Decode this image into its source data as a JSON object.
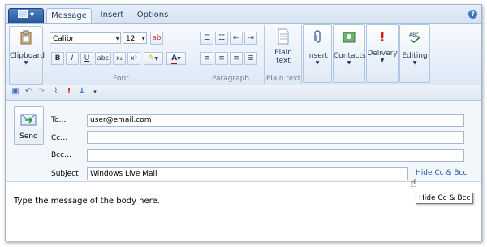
{
  "tabs": {
    "app_menu": "",
    "message": "Message",
    "insert": "Insert",
    "options": "Options"
  },
  "ribbon": {
    "clipboard": "Clipboard",
    "font_label": "Font",
    "font_name": "Calibri",
    "font_size": "12",
    "bold": "B",
    "italic": "I",
    "underline": "U",
    "strike": "abc",
    "subscript": "x₂",
    "superscript": "x²",
    "font_color": "A",
    "paragraph_label": "Paragraph",
    "plain_text_button": "Plain\ntext",
    "plain_text_label": "Plain text",
    "insert": "Insert",
    "contacts": "Contacts",
    "delivery": "Delivery",
    "editing": "Editing"
  },
  "compose": {
    "send": "Send",
    "to_label": "To…",
    "to_value": "user@email.com",
    "cc_label": "Cc…",
    "cc_value": "",
    "bcc_label": "Bcc…",
    "bcc_value": "",
    "subject_label": "Subject",
    "subject_value": "Windows Live Mail",
    "hide_cc_link": "Hide Cc & Bcc",
    "tooltip": "Hide Cc & Bcc",
    "body": "Type the message of the body here."
  },
  "colors": {
    "accent": "#1a5fb4",
    "ribbon_bg": "#dde8f6"
  }
}
